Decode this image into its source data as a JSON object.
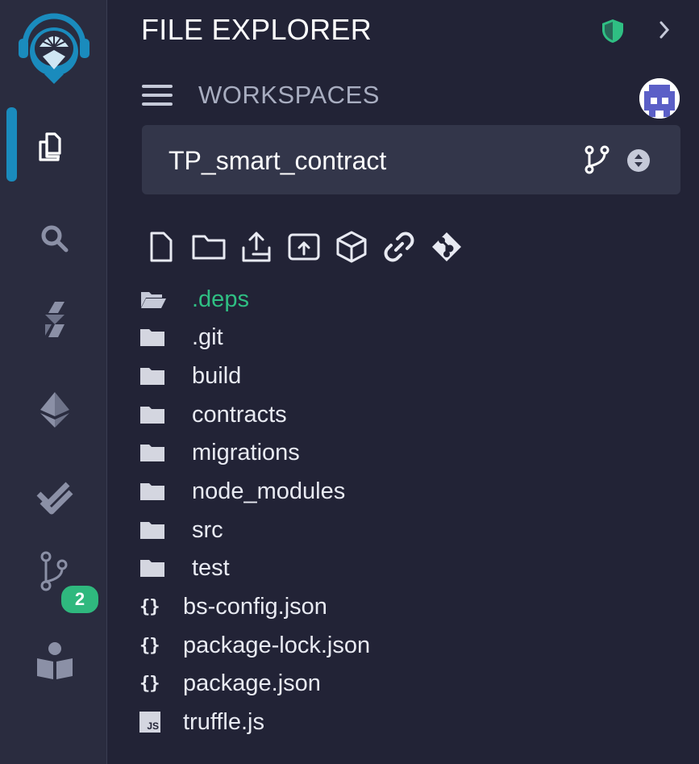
{
  "panel": {
    "title": "FILE EXPLORER",
    "workspaces_label": "WORKSPACES",
    "workspace_name": "TP_smart_contract"
  },
  "sidebar": {
    "items": [
      {
        "name": "file-explorer",
        "icon": "file-explorer-icon",
        "active": true
      },
      {
        "name": "search",
        "icon": "search-icon"
      },
      {
        "name": "solidity-compiler",
        "icon": "solidity-icon"
      },
      {
        "name": "deploy-run",
        "icon": "ethereum-icon"
      },
      {
        "name": "unit-testing",
        "icon": "double-check-icon"
      },
      {
        "name": "source-control",
        "icon": "git-branch-icon",
        "badge": "2"
      },
      {
        "name": "learn",
        "icon": "reader-icon"
      }
    ]
  },
  "toolbar": [
    "new-file-icon",
    "new-folder-icon",
    "upload-file-icon",
    "upload-folder-icon",
    "cube-icon",
    "link-icon",
    "git-icon"
  ],
  "tree": [
    {
      "label": ".deps",
      "type": "folder",
      "open": true
    },
    {
      "label": ".git",
      "type": "folder"
    },
    {
      "label": "build",
      "type": "folder"
    },
    {
      "label": "contracts",
      "type": "folder"
    },
    {
      "label": "migrations",
      "type": "folder"
    },
    {
      "label": "node_modules",
      "type": "folder"
    },
    {
      "label": "src",
      "type": "folder"
    },
    {
      "label": "test",
      "type": "folder"
    },
    {
      "label": "bs-config.json",
      "type": "json"
    },
    {
      "label": "package-lock.json",
      "type": "json"
    },
    {
      "label": "package.json",
      "type": "json"
    },
    {
      "label": "truffle.js",
      "type": "js"
    }
  ],
  "icons": {
    "json_glyph": "{}",
    "js_glyph": "JS"
  },
  "colors": {
    "accent": "#1a8bbd",
    "open_folder": "#2fbf83",
    "badge": "#2fb87e",
    "shield": "#2fbf83"
  }
}
